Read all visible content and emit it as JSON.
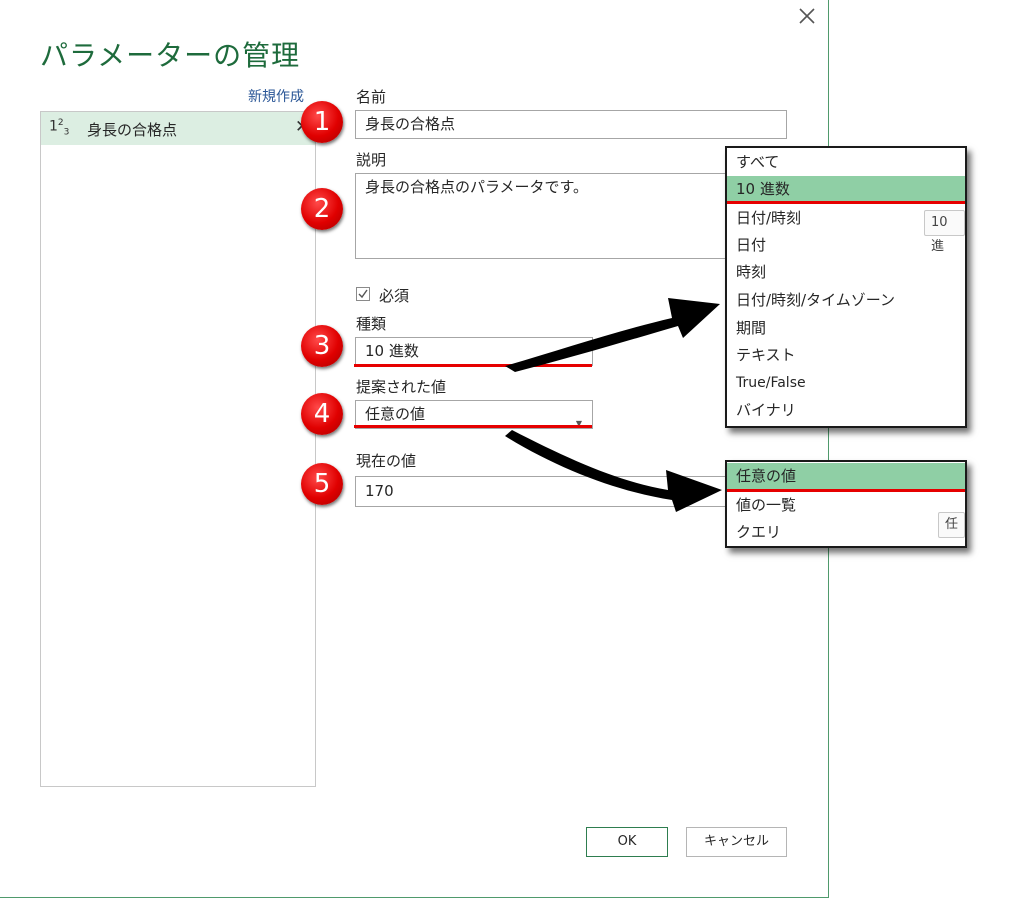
{
  "dialog": {
    "title": "パラメーターの管理",
    "new_link": "新規作成",
    "close_icon": "close-icon",
    "ok_label": "OK",
    "cancel_label": "キャンセル"
  },
  "list": {
    "items": [
      {
        "icon_main": "1",
        "icon_sup": "2",
        "icon_sub": "3",
        "label": "身長の合格点",
        "delete_glyph": "✕"
      }
    ]
  },
  "form": {
    "name_label": "名前",
    "name_value": "身長の合格点",
    "desc_label": "説明",
    "desc_value": "身長の合格点のパラメータです。",
    "required_label": "必須",
    "required_checked": true,
    "type_label": "種類",
    "type_value": "10 進数",
    "suggested_label": "提案された値",
    "suggested_value": "任意の値",
    "current_label": "現在の値",
    "current_value": "170"
  },
  "annotations": {
    "badges": [
      "1",
      "2",
      "3",
      "4",
      "5"
    ],
    "badge_color": "#e00000",
    "underline_color": "#e60000"
  },
  "type_dropdown": {
    "options": [
      "すべて",
      "10 進数",
      "日付/時刻",
      "日付",
      "時刻",
      "日付/時刻/タイムゾーン",
      "期間",
      "テキスト",
      "True/False",
      "バイナリ"
    ],
    "selected_index": 1,
    "tooltip": "10 進"
  },
  "suggested_dropdown": {
    "options": [
      "任意の値",
      "値の一覧",
      "クエリ"
    ],
    "selected_index": 0,
    "tooltip": "任"
  },
  "colors": {
    "accent": "#1e6b3c",
    "selected_bg": "#8fcfa5",
    "list_selected_bg": "#dceee2",
    "link": "#2b5797"
  }
}
